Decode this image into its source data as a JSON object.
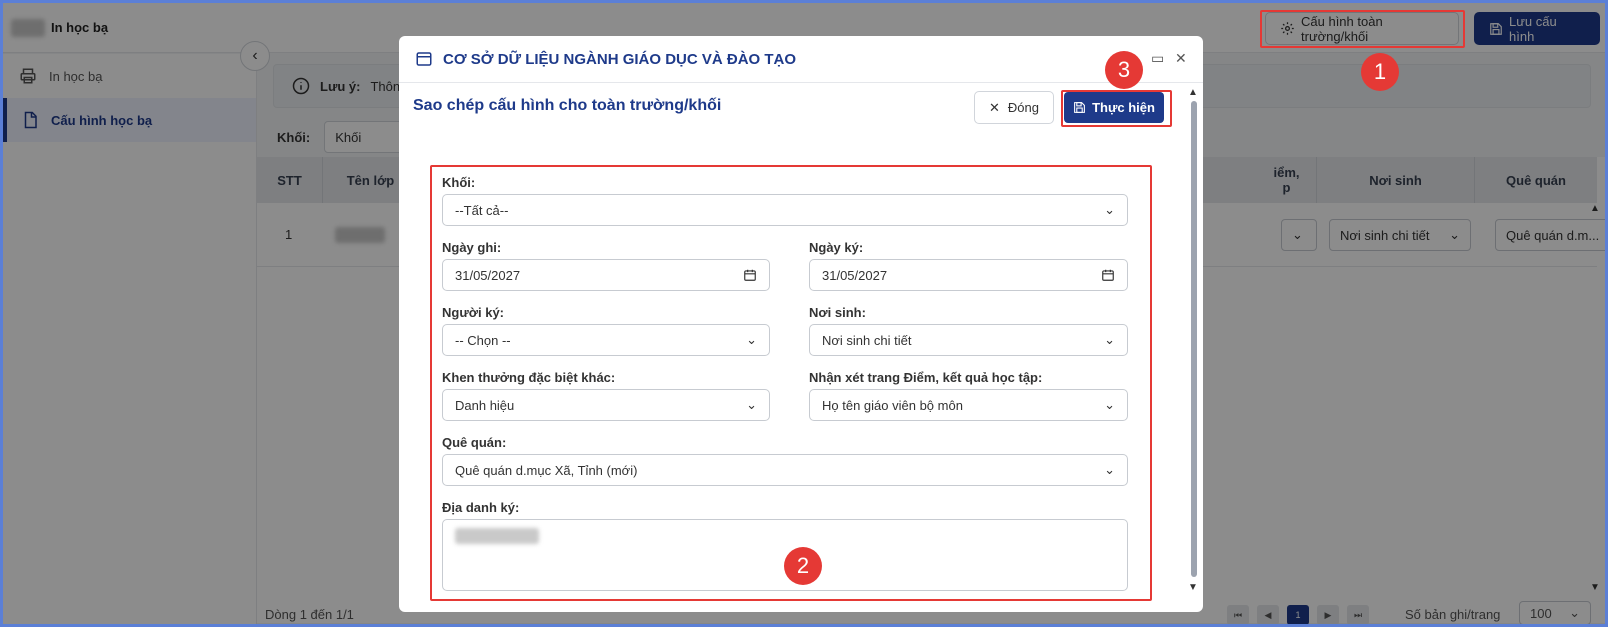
{
  "app": {
    "title": "In học bạ",
    "config_button": "Cấu hình toàn trường/khối",
    "save_button": "Lưu cấu hình"
  },
  "sidebar": {
    "items": [
      {
        "label": "In học bạ",
        "icon": "printer-icon"
      },
      {
        "label": "Cấu hình học bạ",
        "icon": "document-icon"
      }
    ]
  },
  "note": {
    "label": "Lưu ý:",
    "text": "Thông"
  },
  "filter": {
    "khoi_label": "Khối:",
    "khoi_value": "Khối"
  },
  "table": {
    "headers": [
      "STT",
      "Tên lớp",
      "iểm,",
      "p",
      "Nơi sinh",
      "Quê quán"
    ],
    "rows": [
      {
        "stt": "1",
        "noi_sinh": "Nơi sinh chi tiết",
        "que_quan": "Quê quán d.m..."
      }
    ]
  },
  "footer": {
    "rows_info": "Dòng 1 đến 1/1",
    "page": "1",
    "per_page_label": "Số bản ghi/trang",
    "per_page_value": "100"
  },
  "dialog": {
    "title": "CƠ SỞ DỮ LIỆU NGÀNH GIÁO DỤC VÀ ĐÀO TẠO",
    "subtitle": "Sao chép cấu hình cho toàn trường/khối",
    "close_button": "Đóng",
    "execute_button": "Thực hiện",
    "fields": {
      "khoi": {
        "label": "Khối:",
        "value": "--Tất cả--"
      },
      "ngay_ghi": {
        "label": "Ngày ghi:",
        "value": "31/05/2027"
      },
      "ngay_ky": {
        "label": "Ngày ký:",
        "value": "31/05/2027"
      },
      "nguoi_ky": {
        "label": "Người ký:",
        "value": "-- Chọn --"
      },
      "noi_sinh": {
        "label": "Nơi sinh:",
        "value": "Nơi sinh chi tiết"
      },
      "khen_thuong": {
        "label": "Khen thưởng đặc biệt khác:",
        "value": "Danh hiệu"
      },
      "nhan_xet": {
        "label": "Nhận xét trang Điểm, kết quả học tập:",
        "value": "Họ tên giáo viên bộ môn"
      },
      "que_quan": {
        "label": "Quê quán:",
        "value": "Quê quán d.mục Xã, Tỉnh (mới)"
      },
      "dia_danh": {
        "label": "Địa danh ký:",
        "value": ""
      }
    }
  },
  "annotations": {
    "m1": "1",
    "m2": "2",
    "m3": "3"
  },
  "colors": {
    "primary": "#1e3a8a",
    "highlight": "#e53935",
    "overlay": "rgba(0,0,0,0.45)"
  }
}
